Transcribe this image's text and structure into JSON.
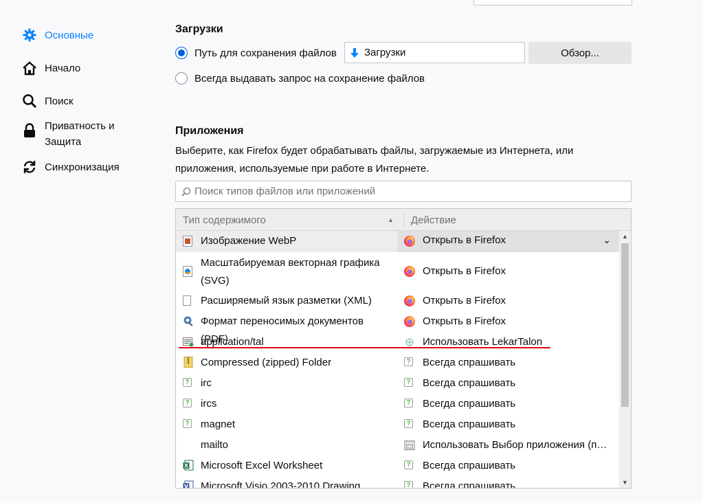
{
  "sidebar": {
    "items": [
      {
        "label": "Основные",
        "icon": "gear-icon",
        "active": true
      },
      {
        "label": "Начало",
        "icon": "home-icon"
      },
      {
        "label": "Поиск",
        "icon": "search-icon"
      },
      {
        "label": "Приватность и Защита",
        "icon": "lock-icon"
      },
      {
        "label": "Синхронизация",
        "icon": "sync-icon"
      }
    ]
  },
  "downloads": {
    "heading": "Загрузки",
    "save_path_label": "Путь для сохранения файлов",
    "save_path_value": "Загрузки",
    "browse_label": "Обзор...",
    "always_ask_label": "Всегда выдавать запрос на сохранение файлов"
  },
  "applications": {
    "heading": "Приложения",
    "description": "Выберите, как Firefox будет обрабатывать файлы, загружаемые из Интернета, или приложения, используемые при работе в Интернете.",
    "search_placeholder": "Поиск типов файлов или приложений",
    "col_type": "Тип содержимого",
    "col_action": "Действие",
    "rows": [
      {
        "type": "Изображение WebP",
        "action": "Открыть в Firefox",
        "action_icon": "firefox-icon",
        "type_icon": "webp-file-icon",
        "selected": true
      },
      {
        "type": "Масштабируемая векторная графика (SVG)",
        "action": "Открыть в Firefox",
        "action_icon": "firefox-icon",
        "type_icon": "svg-file-icon"
      },
      {
        "type": "Расширяемый язык разметки (XML)",
        "action": "Открыть в Firefox",
        "action_icon": "firefox-icon",
        "type_icon": "xml-file-icon"
      },
      {
        "type": "Формат переносимых документов (PDF)",
        "action": "Открыть в Firefox",
        "action_icon": "firefox-icon",
        "type_icon": "pdf-file-icon"
      },
      {
        "type": "application/tal",
        "action": "Использовать LekarTalon",
        "action_icon": "lekartalon-icon",
        "type_icon": "tal-file-icon"
      },
      {
        "type": "Compressed (zipped) Folder",
        "action": "Всегда спрашивать",
        "action_icon": "ask-icon",
        "type_icon": "zip-folder-icon"
      },
      {
        "type": "irc",
        "action": "Всегда спрашивать",
        "action_icon": "ask-icon",
        "type_icon": "protocol-icon"
      },
      {
        "type": "ircs",
        "action": "Всегда спрашивать",
        "action_icon": "ask-icon",
        "type_icon": "protocol-icon"
      },
      {
        "type": "magnet",
        "action": "Всегда спрашивать",
        "action_icon": "ask-icon",
        "type_icon": "protocol-icon"
      },
      {
        "type": "mailto",
        "action": "Использовать Выбор приложения (по ...",
        "action_icon": "app-picker-icon",
        "type_icon": ""
      },
      {
        "type": "Microsoft Excel Worksheet",
        "action": "Всегда спрашивать",
        "action_icon": "ask-icon",
        "type_icon": "excel-icon"
      },
      {
        "type": "Microsoft Visio 2003-2010 Drawing",
        "action": "Всегда спрашивать",
        "action_icon": "ask-icon",
        "type_icon": "visio-icon"
      }
    ]
  },
  "colors": {
    "accent": "#0a84ff",
    "annotation": "#e0001b"
  }
}
